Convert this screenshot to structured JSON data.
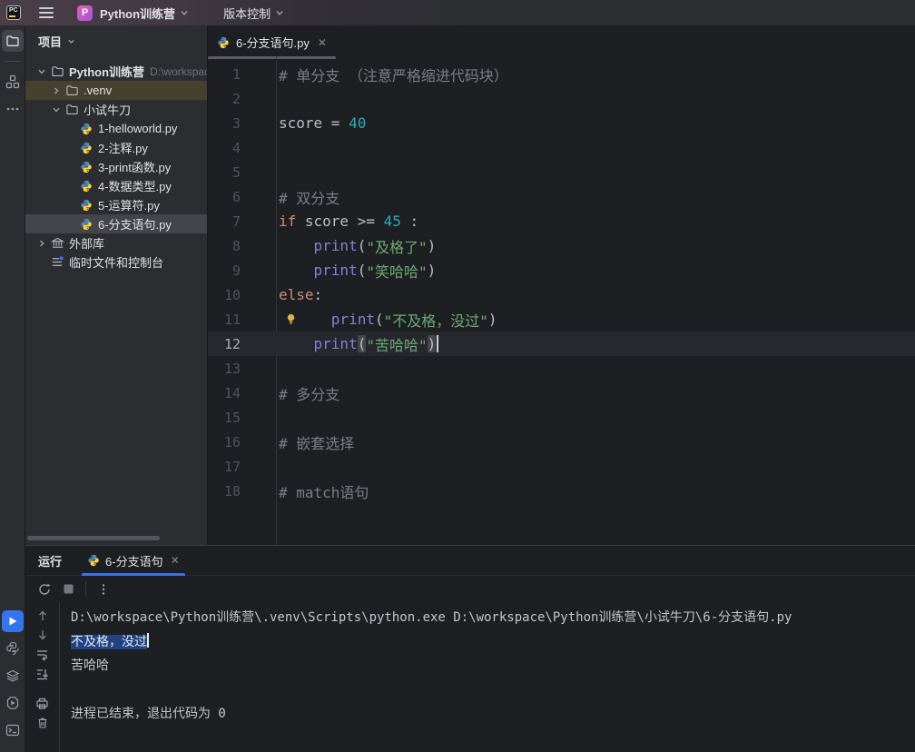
{
  "titlebar": {
    "logo": "PC",
    "project": "Python训练营",
    "vcs": "版本控制"
  },
  "project": {
    "header": "项目",
    "items": [
      {
        "label": "Python训练营",
        "suffix": "D:\\workspace\\P",
        "icon": "folder",
        "chevron": "down",
        "level": 0,
        "bold": true,
        "row": ""
      },
      {
        "label": ".venv",
        "icon": "folder",
        "chevron": "right",
        "level": 1,
        "row": "venv"
      },
      {
        "label": "小试牛刀",
        "icon": "folder",
        "chevron": "down",
        "level": 1,
        "row": ""
      },
      {
        "label": "1-helloworld.py",
        "icon": "python",
        "level": 2,
        "row": ""
      },
      {
        "label": "2-注释.py",
        "icon": "python",
        "level": 2,
        "row": ""
      },
      {
        "label": "3-print函数.py",
        "icon": "python",
        "level": 2,
        "row": ""
      },
      {
        "label": "4-数据类型.py",
        "icon": "python",
        "level": 2,
        "row": ""
      },
      {
        "label": "5-运算符.py",
        "icon": "python",
        "level": 2,
        "row": ""
      },
      {
        "label": "6-分支语句.py",
        "icon": "python",
        "level": 2,
        "row": "selected"
      },
      {
        "label": "外部库",
        "icon": "library",
        "chevron": "right",
        "level": 0,
        "row": ""
      },
      {
        "label": "临时文件和控制台",
        "icon": "scratch",
        "level": 0,
        "row": ""
      }
    ]
  },
  "editor": {
    "tab": "6-分支语句.py",
    "lines": [
      {
        "n": "1",
        "tokens": [
          [
            "comment",
            "# 单分支 （注意严格缩进代码块）"
          ]
        ]
      },
      {
        "n": "2",
        "tokens": []
      },
      {
        "n": "3",
        "tokens": [
          [
            "plain",
            "score = "
          ],
          [
            "number",
            "40"
          ]
        ]
      },
      {
        "n": "4",
        "tokens": []
      },
      {
        "n": "5",
        "tokens": []
      },
      {
        "n": "6",
        "tokens": [
          [
            "comment",
            "# 双分支"
          ]
        ]
      },
      {
        "n": "7",
        "tokens": [
          [
            "keyword",
            "if"
          ],
          [
            "plain",
            " score >= "
          ],
          [
            "number",
            "45"
          ],
          [
            "plain",
            " :"
          ]
        ]
      },
      {
        "n": "8",
        "tokens": [
          [
            "plain",
            "    "
          ],
          [
            "func",
            "print"
          ],
          [
            "plain",
            "("
          ],
          [
            "string",
            "\"及格了\""
          ],
          [
            "plain",
            ")"
          ]
        ]
      },
      {
        "n": "9",
        "tokens": [
          [
            "plain",
            "    "
          ],
          [
            "func",
            "print"
          ],
          [
            "plain",
            "("
          ],
          [
            "string",
            "\"笑哈哈\""
          ],
          [
            "plain",
            ")"
          ]
        ]
      },
      {
        "n": "10",
        "tokens": [
          [
            "keyword",
            "else"
          ],
          [
            "plain",
            ":"
          ]
        ]
      },
      {
        "n": "11",
        "bulb": true,
        "tokens": [
          [
            "plain",
            "      "
          ],
          [
            "func",
            "print"
          ],
          [
            "plain",
            "("
          ],
          [
            "string",
            "\"不及格，没过\""
          ],
          [
            "plain",
            ")"
          ]
        ]
      },
      {
        "n": "12",
        "current": true,
        "caret": true,
        "tokens": [
          [
            "plain",
            "    "
          ],
          [
            "func",
            "print"
          ],
          [
            "brace",
            "("
          ],
          [
            "string",
            "\"苦哈哈\""
          ],
          [
            "brace",
            ")"
          ]
        ]
      },
      {
        "n": "13",
        "tokens": []
      },
      {
        "n": "14",
        "tokens": [
          [
            "comment",
            "# 多分支"
          ]
        ]
      },
      {
        "n": "15",
        "tokens": []
      },
      {
        "n": "16",
        "tokens": [
          [
            "comment",
            "# 嵌套选择"
          ]
        ]
      },
      {
        "n": "17",
        "tokens": []
      },
      {
        "n": "18",
        "tokens": [
          [
            "comment",
            "# match语句"
          ]
        ]
      }
    ]
  },
  "run": {
    "tool_label": "运行",
    "tab": "6-分支语句",
    "console": [
      {
        "segs": [
          [
            "plain",
            "D:\\workspace\\Python训练营\\.venv\\Scripts\\python.exe D:\\workspace\\Python训练营\\小试牛刀\\6-分支语句.py"
          ]
        ]
      },
      {
        "segs": [
          [
            "selected",
            "不及格，没过"
          ]
        ],
        "caret": true
      },
      {
        "segs": [
          [
            "plain",
            "苦哈哈"
          ]
        ]
      },
      {
        "segs": []
      },
      {
        "segs": [
          [
            "plain",
            "进程已结束，退出代码为 0"
          ]
        ]
      }
    ]
  },
  "colors": {
    "accent": "#3574f0",
    "keyword": "#cf8e6d",
    "string": "#6aab73",
    "number": "#2aacb8",
    "comment": "#7a7e85",
    "builtin": "#8480d8",
    "selection": "#214283",
    "panel_bg": "#2b2d30",
    "editor_bg": "#1e1f22",
    "venv_row": "#48402f",
    "selected_row": "#43454a"
  }
}
